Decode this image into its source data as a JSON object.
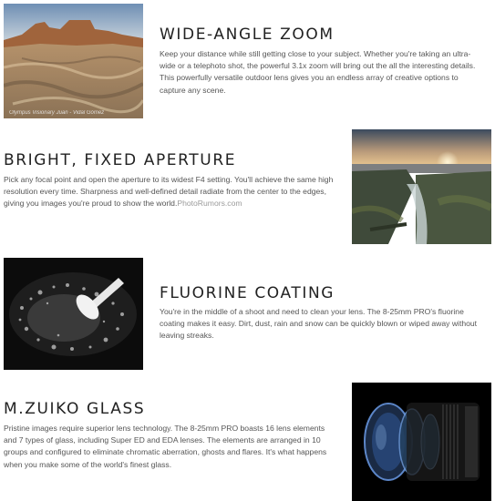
{
  "sections": [
    {
      "title": "WIDE-ANGLE ZOOM",
      "body": "Keep your distance while still getting close to your subject. Whether you're taking an ultra-wide or a telephoto shot, the powerful 3.1x zoom will bring out the all the interesting details. This powerfully versatile outdoor lens gives you an endless array of creative options to capture any scene.",
      "image_caption": "Olympus Visionary Juan - Vidal Gómez",
      "image": "badlands-landscape-photo"
    },
    {
      "title": "BRIGHT, FIXED APERTURE",
      "body": "Pick any focal point and open the aperture to its widest F4 setting. You'll achieve the same high resolution every time. Sharpness and well-defined detail radiate from the center to the edges, giving you images you're proud to show the world.",
      "credit": "PhotoRumors.com",
      "image": "sunset-rocky-coast-photo"
    },
    {
      "title": "FLUORINE COATING",
      "body": "You're in the middle of a shoot and need to clean your lens. The 8-25mm PRO's fluorine coating makes it easy. Dirt, dust, rain and snow can be quickly blown or wiped away without leaving streaks.",
      "image": "water-droplets-lens-photo"
    },
    {
      "title": "M.ZUIKO GLASS",
      "body": "Pristine images require superior lens technology. The 8-25mm PRO boasts 16 lens elements and 7 types of glass, including Super ED and EDA lenses. The elements are arranged in 10 groups and configured to eliminate chromatic aberration, ghosts and flares. It's what happens when you make some of the world's finest glass.",
      "image": "lens-cutaway-render"
    }
  ]
}
